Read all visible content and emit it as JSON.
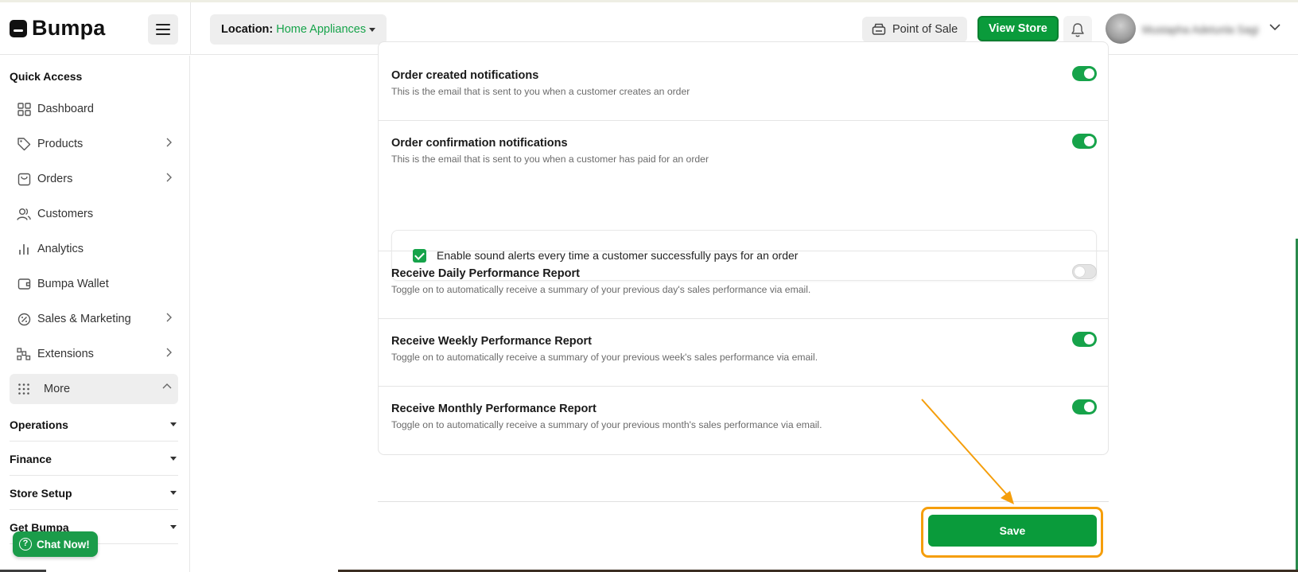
{
  "header": {
    "logo_text": "Bumpa",
    "location_label": "Location:",
    "location_value": "Home Appliances",
    "pos_label": "Point of Sale",
    "view_store_label": "View Store",
    "user_name": "Mustapha Adetunla Sagi"
  },
  "sidebar": {
    "quick_access_title": "Quick Access",
    "items": [
      {
        "label": "Dashboard",
        "icon": "dashboard-icon"
      },
      {
        "label": "Products",
        "icon": "tag-icon"
      },
      {
        "label": "Orders",
        "icon": "shopping-bag-icon"
      },
      {
        "label": "Customers",
        "icon": "users-icon"
      },
      {
        "label": "Analytics",
        "icon": "bar-chart-icon"
      },
      {
        "label": "Bumpa Wallet",
        "icon": "wallet-icon"
      },
      {
        "label": "Sales & Marketing",
        "icon": "discount-icon"
      },
      {
        "label": "Extensions",
        "icon": "extensions-icon"
      },
      {
        "label": "More",
        "icon": "grid-dots-icon"
      }
    ],
    "sections": [
      "Operations",
      "Finance",
      "Store Setup",
      "Get Bumpa"
    ],
    "chat_label": "Chat Now!"
  },
  "settings": {
    "rows": [
      {
        "title": "Order created notifications",
        "description": "This is the email that is sent to you when a customer creates an order",
        "enabled": true
      },
      {
        "title": "Order confirmation notifications",
        "description": "This is the email that is sent to you when a customer has paid for an order",
        "enabled": true
      },
      {
        "title": "Receive Daily Performance Report",
        "description": "Toggle on to automatically receive a summary of your previous day's sales performance via email.",
        "enabled": false
      },
      {
        "title": "Receive Weekly Performance Report",
        "description": "Toggle on to automatically receive a summary of your previous week's sales performance via email.",
        "enabled": true
      },
      {
        "title": "Receive Monthly Performance Report",
        "description": "Toggle on to automatically receive a summary of your previous month's sales performance via email.",
        "enabled": true
      }
    ],
    "sound_alert_label": "Enable sound alerts every time a customer successfully pays for an order",
    "sound_alert_checked": true,
    "save_label": "Save"
  },
  "colors": {
    "brand_green": "#0a9b3b",
    "toggle_on": "#16a34a",
    "highlight": "#f59e0b"
  }
}
